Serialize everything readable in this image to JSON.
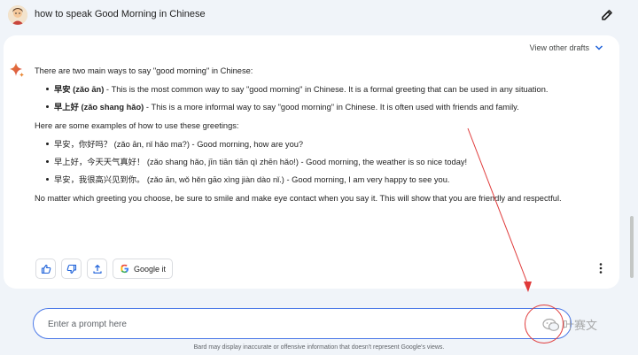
{
  "header": {
    "query": "how to speak Good Morning in Chinese"
  },
  "response": {
    "view_drafts": "View other drafts",
    "intro": "There are two main ways to say \"good morning\" in Chinese:",
    "ways": [
      {
        "bold": "早安 (zǎo ān)",
        "text": " - This is the most common way to say \"good morning\" in Chinese. It is a formal greeting that can be used in any situation."
      },
      {
        "bold": "早上好 (zǎo shang hǎo)",
        "text": " - This is a more informal way to say \"good morning\" in Chinese. It is often used with friends and family."
      }
    ],
    "examples_intro": "Here are some examples of how to use these greetings:",
    "examples": [
      "早安，你好吗？ (zǎo ān, nǐ hǎo ma?) - Good morning, how are you?",
      "早上好，今天天气真好！ (zǎo shang hǎo, jīn tiān tiān qì zhēn hǎo!) - Good morning, the weather is so nice today!",
      "早安，我很高兴见到你。 (zǎo ān, wǒ hěn gāo xìng jiàn dào nǐ.) - Good morning, I am very happy to see you."
    ],
    "closing": "No matter which greeting you choose, be sure to smile and make eye contact when you say it. This will show that you are friendly and respectful."
  },
  "actions": {
    "google_it": "Google it"
  },
  "prompt": {
    "placeholder": "Enter a prompt here"
  },
  "disclaimer": "Bard may display inaccurate or offensive information that doesn't represent Google's views.",
  "watermark": "叶赛文",
  "colors": {
    "accent": "#4b79e8",
    "annotation": "#e03a3a",
    "background": "#f0f4f9"
  },
  "icons": [
    "edit-icon",
    "chevron-down-icon",
    "bard-sparkle-icon",
    "thumbs-up-icon",
    "thumbs-down-icon",
    "share-icon",
    "google-g-icon",
    "more-vert-icon"
  ]
}
